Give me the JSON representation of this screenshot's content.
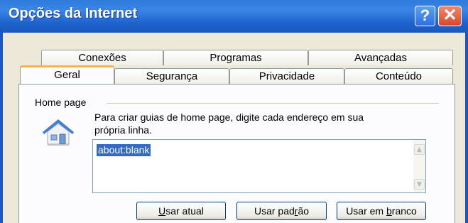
{
  "window": {
    "title": "Opções da Internet",
    "help_label": "?",
    "close_label": "✕"
  },
  "tabs_row_back": [
    "Conexões",
    "Programas",
    "Avançadas"
  ],
  "tabs_row_front": [
    "Geral",
    "Segurança",
    "Privacidade",
    "Conteúdo"
  ],
  "active_tab": "Geral",
  "home_page": {
    "group_label": "Home page",
    "description_line1": "Para criar guias de home page, digite cada endereço em sua",
    "description_line2": "própria linha.",
    "value": "about:blank",
    "icon": "house-icon"
  },
  "buttons": {
    "use_current": {
      "pre": "",
      "u": "U",
      "post": "sar atual"
    },
    "use_default": {
      "pre": "Usar pad",
      "u": "r",
      "post": "ão"
    },
    "use_blank": {
      "pre": "Usar em ",
      "u": "b",
      "post": "ranco"
    }
  },
  "colors": {
    "titlebar": "#2f7bdc",
    "tab_highlight": "#f7b640",
    "selection": "#316ac5"
  }
}
